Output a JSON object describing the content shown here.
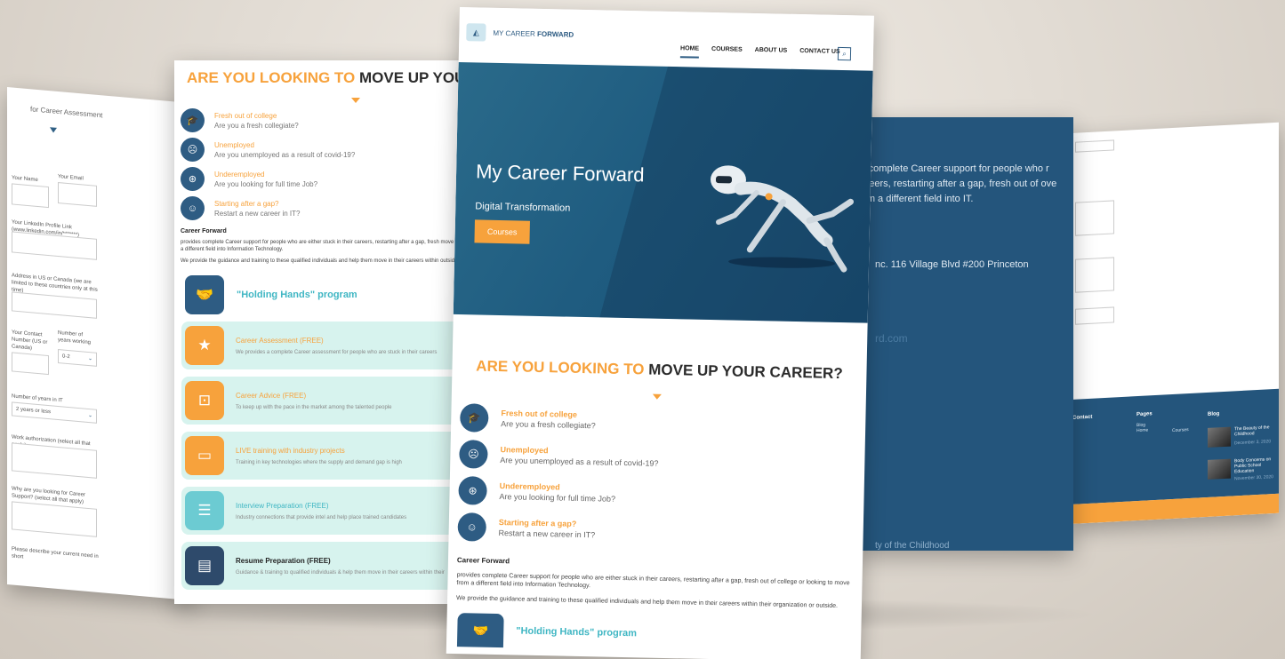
{
  "form_page": {
    "title": "for Career Assessment",
    "fields": {
      "name": "Your Name",
      "email": "Your Email",
      "linkedin": "Your LinkedIn Profile Link (www.linkedin.com/in/*******)",
      "address": "Address in US or Canada (we are limited to these countries only at this time)",
      "contact": "Your Contact Number (US or Canada)",
      "years_working": "Number of years working",
      "years_working_value": "0-2",
      "years_it": "Number of years in IT",
      "years_it_value": "2 years or less",
      "work_auth": "Work authorization (select all that apply)",
      "why": "Why are you looking for Career Support? (select all that apply)",
      "describe": "Please describe your current need in short"
    }
  },
  "features_page": {
    "heading_highlight": "ARE YOU LOOKING TO",
    "heading_rest": "MOVE UP YOUR",
    "items": [
      {
        "title": "Fresh out of college",
        "subtitle": "Are you a fresh collegiate?",
        "icon": "graduation-cap-icon"
      },
      {
        "title": "Unemployed",
        "subtitle": "Are you unemployed as a result of covid-19?",
        "icon": "sad-face-icon"
      },
      {
        "title": "Underemployed",
        "subtitle": "Are you looking for full time Job?",
        "icon": "compass-icon"
      },
      {
        "title": "Starting after a gap?",
        "subtitle": "Restart a new career in IT?",
        "icon": "smile-face-icon"
      }
    ],
    "cf_title": "Career Forward",
    "cf_p1": "provides complete Career support for people who are either stuck in their careers, restarting after a gap, fresh move from a different field into Information Technology.",
    "cf_p2": "We provide the guidance and training to these qualified individuals and help them move in their careers within outside.",
    "holding_title": "\"Holding Hands\" program",
    "services": [
      {
        "title": "Career Assessment (FREE)",
        "subtitle": "We provides a complete Career assessment for people who are stuck in their careers",
        "icon": "star-icon",
        "color": "#f7a23c"
      },
      {
        "title": "Career Advice (FREE)",
        "subtitle": "To keep up with the pace in the market among the talented people",
        "icon": "presentation-icon",
        "color": "#f7a23c"
      },
      {
        "title": "LIVE training with industry projects",
        "subtitle": "Training in key technologies where the supply and demand gap is high",
        "icon": "monitor-icon",
        "color": "#f7a23c"
      },
      {
        "title": "Interview Preparation (FREE)",
        "subtitle": "Industry connections that provide intel and help place trained candidates",
        "icon": "clipboard-icon",
        "color": "#6ccbd2"
      },
      {
        "title": "Resume Preparation (FREE)",
        "subtitle": "Guidance & training to qualified individuals & help them move in their careers within their",
        "icon": "document-icon",
        "color": "#2e4a6b"
      }
    ]
  },
  "about_page": {
    "paragraph": "es complete Career support for people who r careers, restarting after a gap, fresh out of ove from a different field into IT.",
    "address": "nc. 116 Village Blvd #200 Princeton",
    "email": "rd.com",
    "footer": "ty of the Childhood"
  },
  "footer_page": {
    "contact_title": "Contact",
    "pages_title": "Pages",
    "pages_links": [
      "Blog",
      "Home",
      "Courses"
    ],
    "blog_title": "Blog",
    "blog_posts": [
      {
        "title": "The Beauty of the Childhood",
        "date": "December 3, 2020"
      },
      {
        "title": "Body Concerns on Public School Education",
        "date": "November 30, 2020"
      }
    ]
  },
  "main_page": {
    "brand": "MY CAREER",
    "brand_bold": "FORWARD",
    "nav": [
      "HOME",
      "COURSES",
      "ABOUT US",
      "CONTACT US"
    ],
    "hero_title": "My Career Forward",
    "hero_subtitle": "Digital Transformation",
    "hero_button": "Courses",
    "heading_highlight": "ARE YOU LOOKING TO",
    "heading_rest": "MOVE UP YOUR CAREER?",
    "items": [
      {
        "title": "Fresh out of college",
        "subtitle": "Are you a fresh collegiate?",
        "icon": "graduation-cap-icon"
      },
      {
        "title": "Unemployed",
        "subtitle": "Are you unemployed as a result of covid-19?",
        "icon": "sad-face-icon"
      },
      {
        "title": "Underemployed",
        "subtitle": "Are you looking for full time Job?",
        "icon": "compass-icon"
      },
      {
        "title": "Starting after a gap?",
        "subtitle": "Restart a new career in IT?",
        "icon": "smile-face-icon"
      }
    ],
    "cf_title": "Career Forward",
    "cf_p1": "provides complete Career support for people who are either stuck in their careers, restarting after a gap, fresh out of college or looking to move from a different field into Information Technology.",
    "cf_p2": "We provide the guidance and training to these qualified individuals and help them move in their careers within their organization or outside.",
    "holding_title": "\"Holding Hands\" program"
  },
  "colors": {
    "accent": "#f7a23c",
    "brand": "#2e5c83",
    "teal": "#3fb6c3",
    "service_bg": "#d7f3ee"
  }
}
